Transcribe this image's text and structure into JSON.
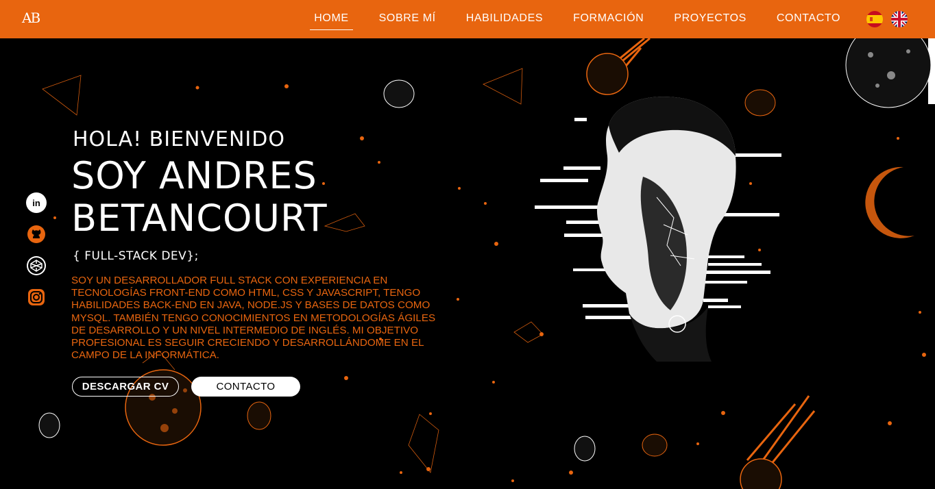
{
  "brand": {
    "logo_text": "AB"
  },
  "nav": {
    "items": [
      {
        "label": "HOME",
        "active": true
      },
      {
        "label": "SOBRE MÍ",
        "active": false
      },
      {
        "label": "HABILIDADES",
        "active": false
      },
      {
        "label": "FORMACIÓN",
        "active": false
      },
      {
        "label": "PROYECTOS",
        "active": false
      },
      {
        "label": "CONTACTO",
        "active": false
      }
    ],
    "languages": [
      {
        "code": "es",
        "icon": "spain-flag-icon"
      },
      {
        "code": "en",
        "icon": "uk-flag-icon"
      }
    ]
  },
  "social": [
    {
      "icon": "linkedin-icon"
    },
    {
      "icon": "github-icon"
    },
    {
      "icon": "codepen-icon"
    },
    {
      "icon": "instagram-icon"
    }
  ],
  "hero": {
    "greeting": "HOLA! BIENVENIDO",
    "name_line1": "SOY ANDRES",
    "name_line2": "BETANCOURT",
    "role": "{ FULL-STACK DEV};",
    "description": "Soy un desarrollador Full Stack con experiencia en tecnologías Front-End como HTML, CSS y JavaScript, tengo habilidades Back-End en Java, Node.js y bases de datos como MySQL. También tengo conocimientos en metodologías ágiles de desarrollo y un nivel intermedio de inglés. Mi objetivo profesional es seguir creciendo y desarrollándome en el campo de la informática.",
    "btn_cv": "DESCARGAR CV",
    "btn_contact": "CONTACTO"
  },
  "colors": {
    "accent": "#e8650f",
    "background": "#000000",
    "text": "#ffffff"
  }
}
